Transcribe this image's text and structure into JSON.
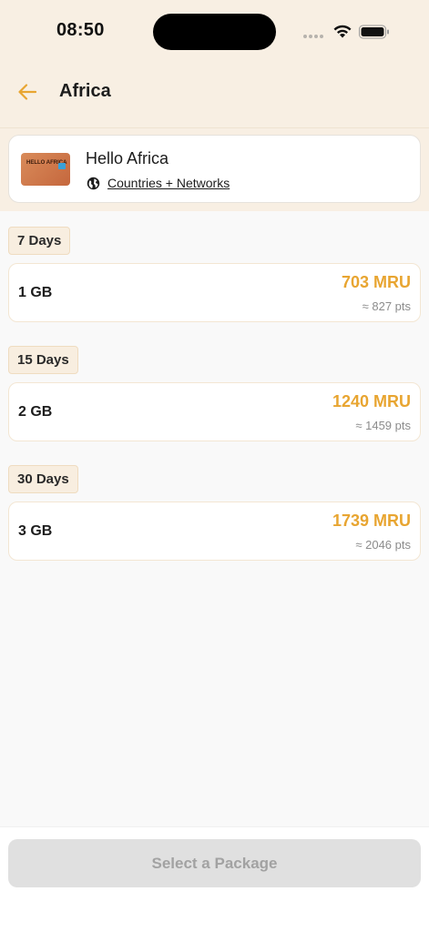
{
  "status_bar": {
    "time": "08:50"
  },
  "header": {
    "title": "Africa"
  },
  "plan": {
    "name": "Hello Africa",
    "thumb_text": "HELLO AFRICA",
    "link_label": "Countries + Networks"
  },
  "sections": [
    {
      "duration": "7 Days",
      "data": "1 GB",
      "price": "703 MRU",
      "points": "≈ 827 pts"
    },
    {
      "duration": "15 Days",
      "data": "2 GB",
      "price": "1240 MRU",
      "points": "≈ 1459 pts"
    },
    {
      "duration": "30 Days",
      "data": "3 GB",
      "price": "1739 MRU",
      "points": "≈ 2046 pts"
    }
  ],
  "footer": {
    "button_label": "Select a Package"
  },
  "colors": {
    "accent": "#e8a531",
    "header_bg": "#f8efe3",
    "badge_bg": "#f8eee0",
    "disabled_button": "#e0e0e0"
  }
}
